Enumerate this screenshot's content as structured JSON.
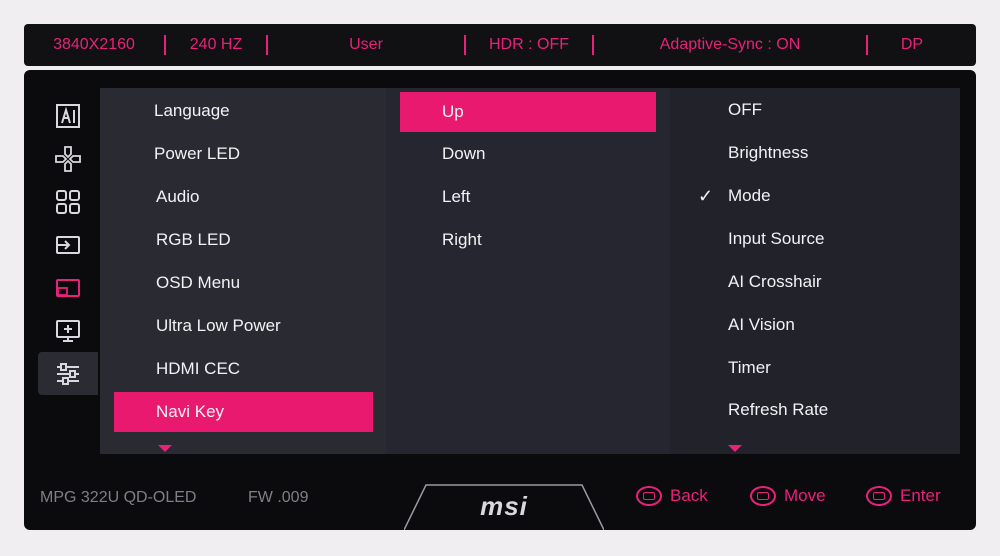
{
  "status_bar": {
    "resolution": "3840X2160",
    "refresh": "240 HZ",
    "mode": "User",
    "hdr": "HDR : OFF",
    "adaptive_sync": "Adaptive-Sync : ON",
    "input": "DP"
  },
  "side_icons": [
    "ai-icon",
    "gamepad-icon",
    "grid-icon",
    "input-source-icon",
    "pip-icon",
    "monitor-settings-icon",
    "sliders-icon"
  ],
  "menu": {
    "items": [
      "Language",
      "Power LED",
      "Audio",
      "RGB LED",
      "OSD Menu",
      "Ultra Low Power",
      "HDMI CEC",
      "Navi Key"
    ],
    "selected": "Navi Key"
  },
  "navi_key": {
    "items": [
      "Up",
      "Down",
      "Left",
      "Right"
    ],
    "selected": "Up"
  },
  "functions": {
    "items": [
      "OFF",
      "Brightness",
      "Mode",
      "Input Source",
      "AI Crosshair",
      "AI Vision",
      "Timer",
      "Refresh Rate"
    ],
    "checked": "Mode"
  },
  "footer": {
    "model": "MPG 322U QD-OLED",
    "firmware": "FW .009",
    "logo": "msi",
    "back_label": "Back",
    "move_label": "Move",
    "enter_label": "Enter"
  },
  "colors": {
    "accent": "#e8217a",
    "panel": "#2a2a33",
    "background": "#0b0b0d"
  }
}
